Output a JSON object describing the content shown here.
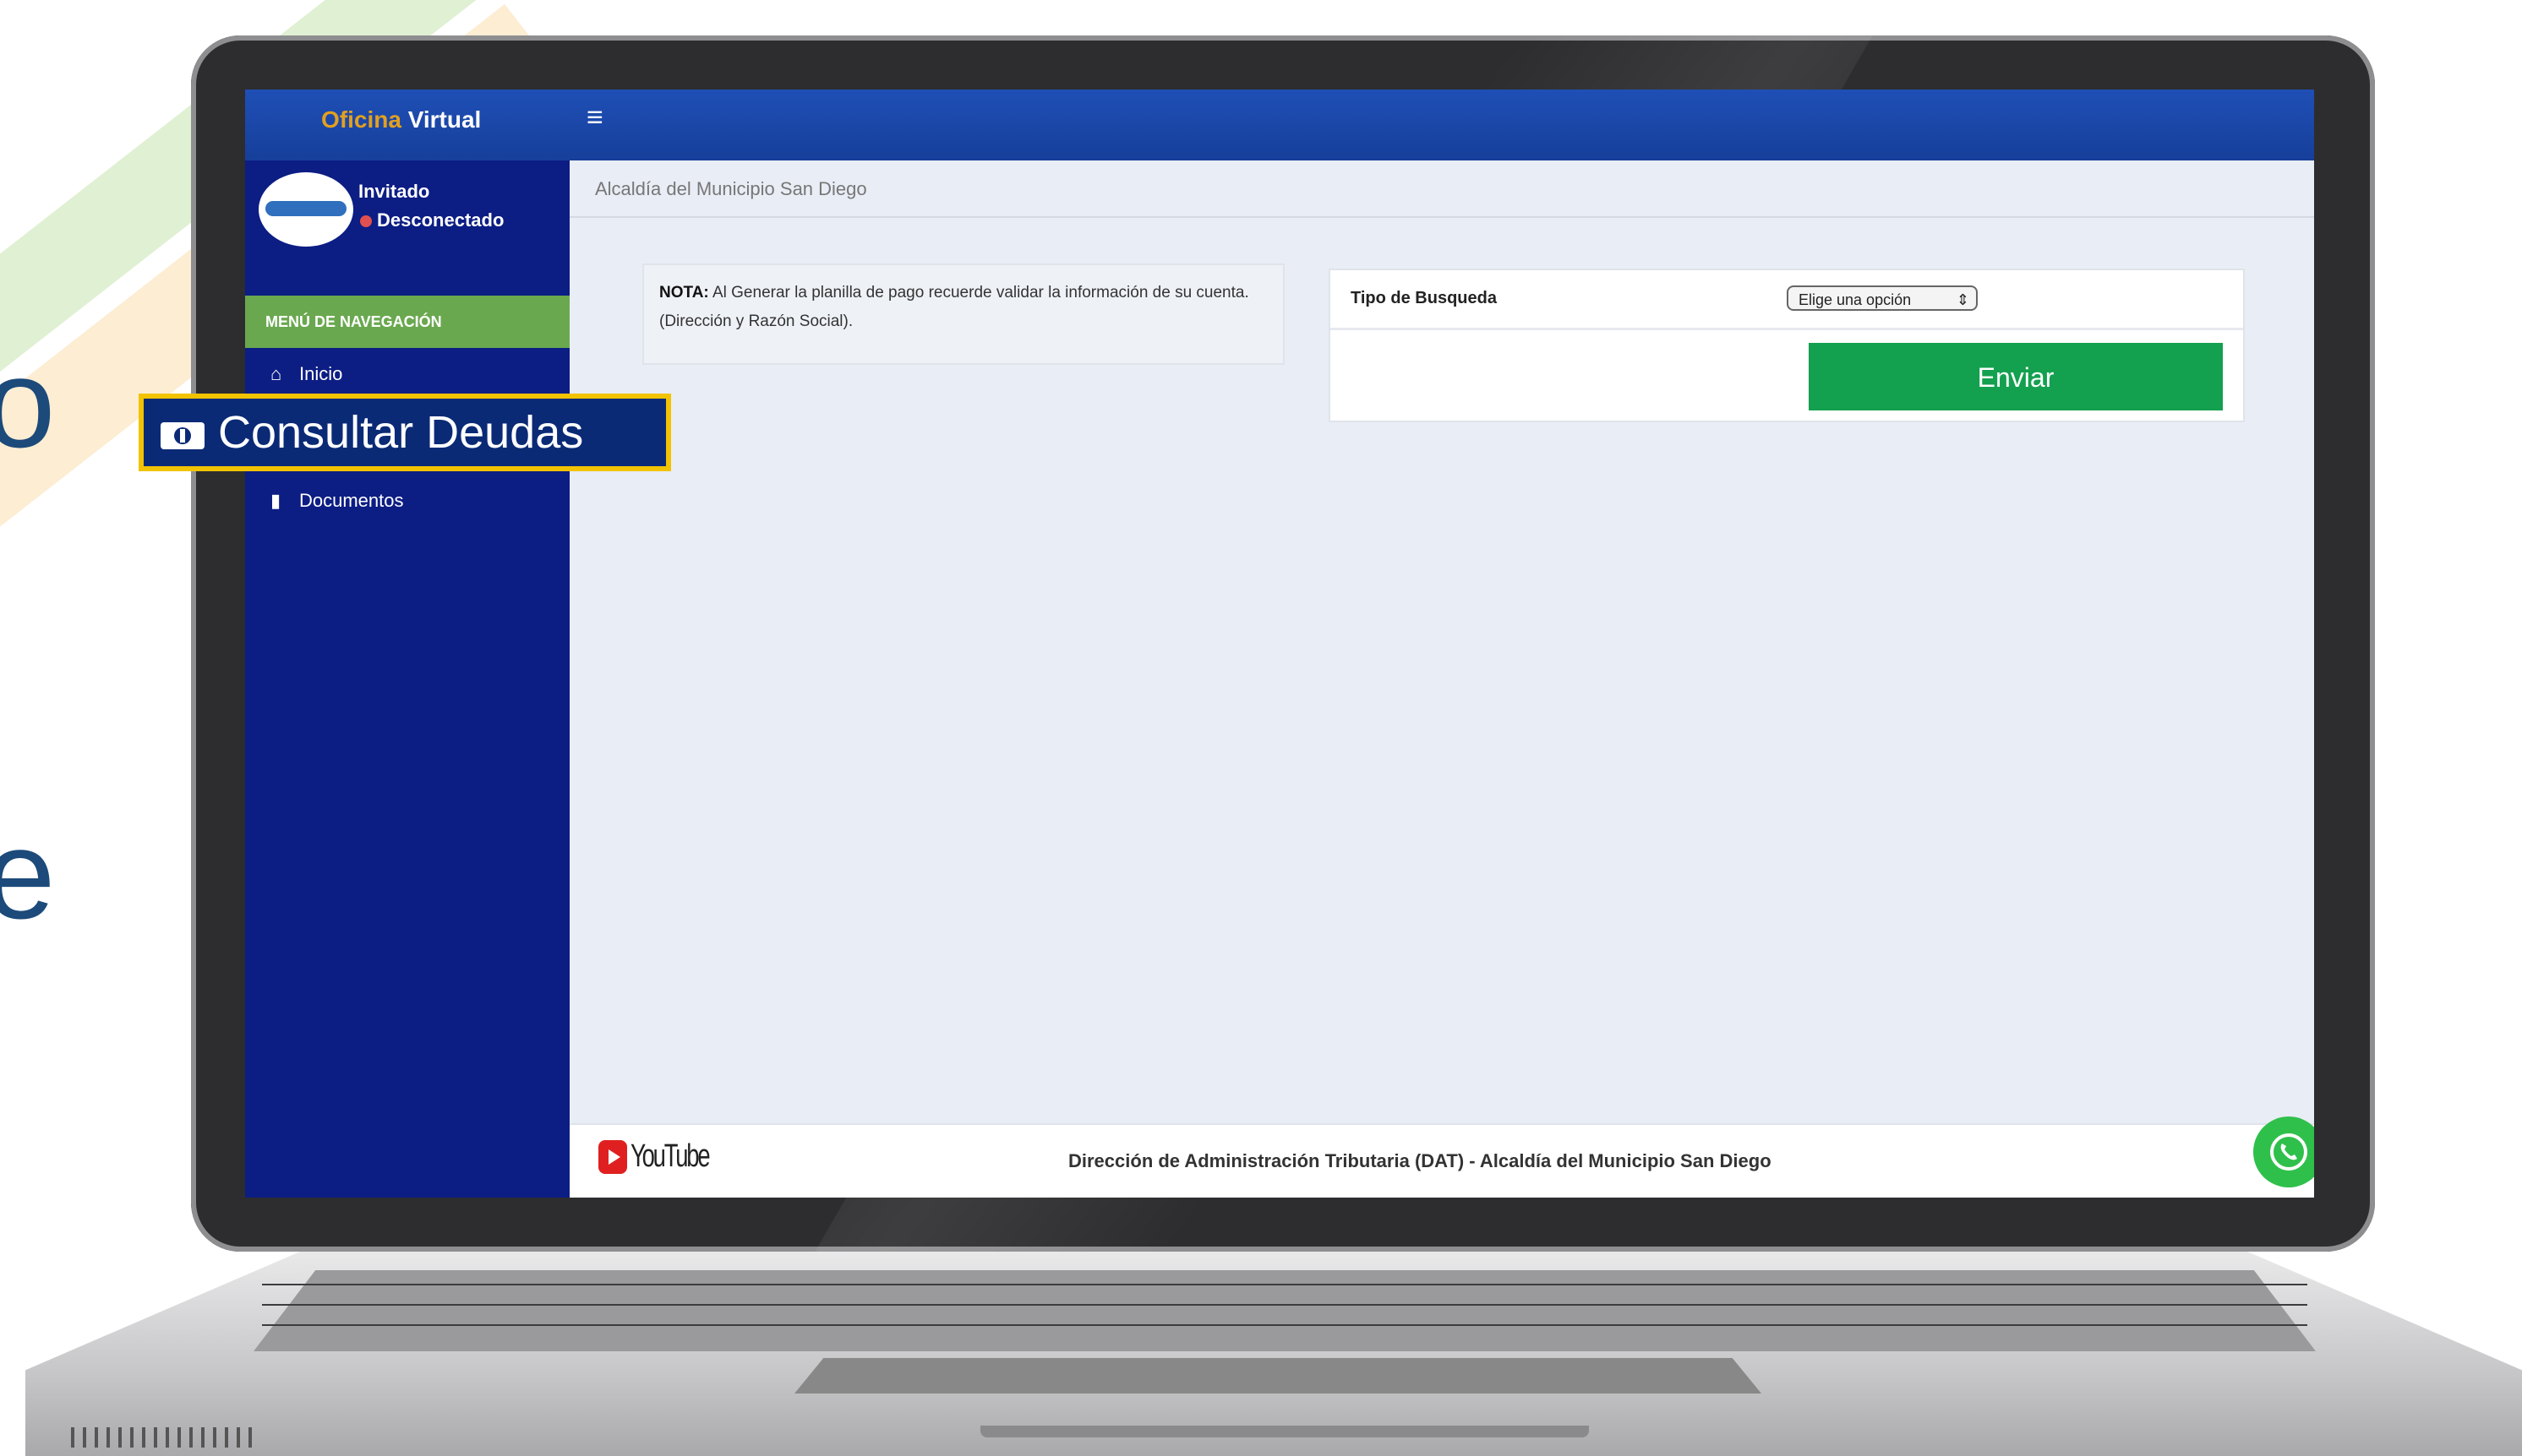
{
  "app": {
    "brand_part1": "Oficina",
    "brand_part2": "Virtual",
    "menu_icon": "hamburger-menu-icon"
  },
  "user": {
    "name": "Invitado",
    "status": "Desconectado"
  },
  "sidebar": {
    "header": "MENÚ DE NAVEGACIÓN",
    "items": [
      {
        "label": "Inicio",
        "icon": "home-icon"
      },
      {
        "label": "Consultar Deudas",
        "icon": "money-bill-icon"
      },
      {
        "label": "Documentos",
        "icon": "document-icon"
      }
    ]
  },
  "breadcrumb": "Alcaldía del Municipio San Diego",
  "note": {
    "label": "NOTA:",
    "text": "Al Generar la planilla de pago recuerde validar la información de su cuenta. (Dirección y Razón Social)."
  },
  "search": {
    "label": "Tipo de Busqueda",
    "select_value": "Elige una opción",
    "submit_label": "Enviar"
  },
  "footer": {
    "youtube_label": "YouTube",
    "text": "Dirección de Administración Tributaria (DAT) - Alcaldía del Municipio San Diego",
    "whatsapp_icon": "whatsapp-icon"
  },
  "colors": {
    "topbar": "#1f4fb6",
    "sidebar": "#0c1d84",
    "nav_header": "#6aa84f",
    "submit_button": "#13a04f",
    "highlight_border": "#f2c300"
  },
  "side_letters": [
    "o",
    "e"
  ]
}
